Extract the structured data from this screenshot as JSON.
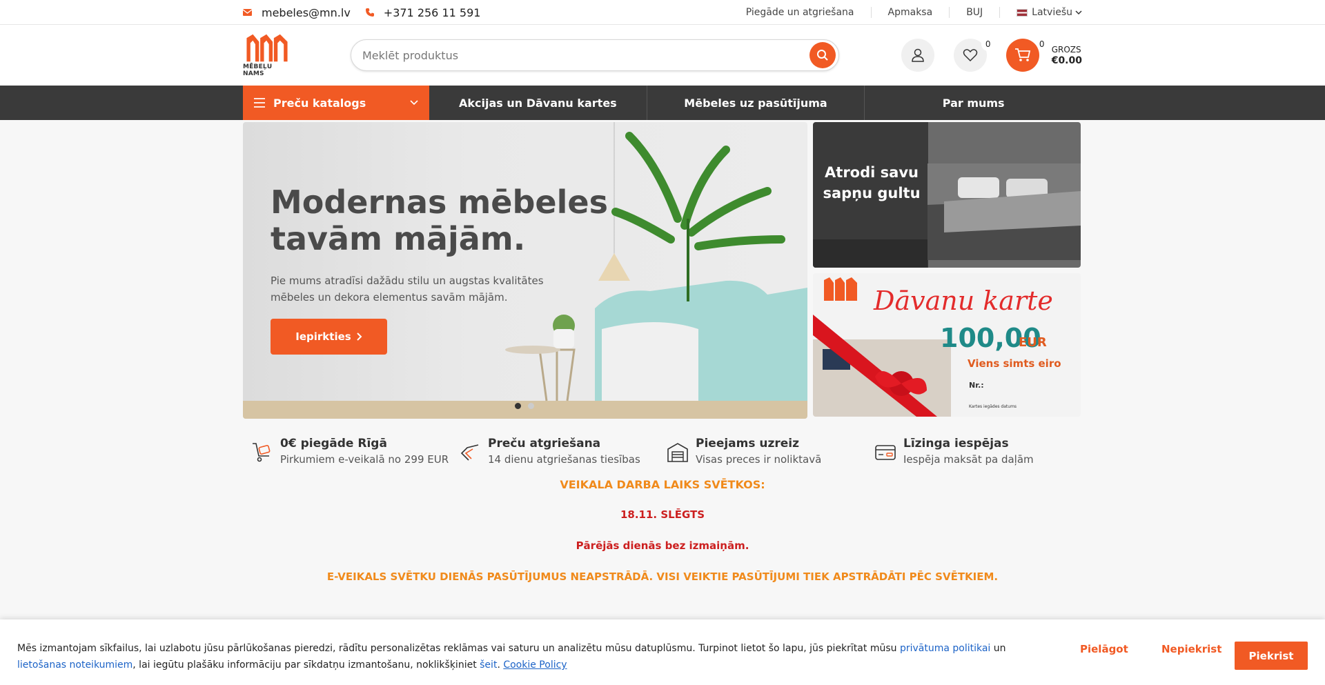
{
  "topbar": {
    "email": "mebeles@mn.lv",
    "phone": "+371 256 11 591",
    "links": [
      "Piegāde un atgriešana",
      "Apmaksa",
      "BUJ"
    ],
    "language": "Latviešu"
  },
  "header": {
    "logo_text": "MĒBEĻU NAMS",
    "search_placeholder": "Meklēt produktus",
    "wishlist_count": "0",
    "cart_count": "0",
    "cart_label": "GROZS",
    "cart_total": "€0.00"
  },
  "nav": {
    "catalog": "Preču katalogs",
    "items": [
      "Akcijas un Dāvanu kartes",
      "Mēbeles uz pasūtījuma",
      "Par mums"
    ]
  },
  "hero": {
    "title": "Modernas mēbeles tavām mājām.",
    "text": "Pie mums atradīsi dažādu stilu un augstas kvalitātes mēbeles un dekora elementus savām mājām.",
    "button": "Iepirkties"
  },
  "side_banners": {
    "bed_title": "Atrodi savu sapņu gultu",
    "gift_title": "Dāvanu karte",
    "gift_value": "100,00",
    "gift_currency": "EUR",
    "gift_words": "Viens simts eiro",
    "gift_nr": "Nr.:",
    "gift_date": "Kartes iegādes datums"
  },
  "features": [
    {
      "title": "0€ piegāde Rīgā",
      "sub": "Pirkumiem e-veikalā no 299 EUR",
      "icon": "delivery-cart-icon"
    },
    {
      "title": "Preču atgriešana",
      "sub": "14 dienu atgriešanas tiesības",
      "icon": "return-arrow-icon"
    },
    {
      "title": "Pieejams uzreiz",
      "sub": "Visas preces ir noliktavā",
      "icon": "warehouse-icon"
    },
    {
      "title": "Līzinga iespējas",
      "sub": "Iespēja maksāt pa daļām",
      "icon": "credit-card-icon"
    }
  ],
  "notices": {
    "n1": "VEIKALA DARBA LAIKS SVĒTKOS:",
    "n2": "18.11.  SLĒGTS",
    "n3": "Pārējās dienās bez izmaiņām.",
    "n4": "E-VEIKALS SVĒTKU DIENĀS PASŪTĪJUMUS NEAPSTRĀDĀ. VISI VEIKTIE PASŪTĪJUMI TIEK APSTRĀDĀTI PĒC SVĒTKIEM."
  },
  "cookie": {
    "text_a": "Mēs izmantojam sīkfailus, lai uzlabotu jūsu pārlūkošanas pieredzi, rādītu personalizētas reklāmas vai saturu un analizētu mūsu datuplūsmu. Turpinot lietot šo lapu, jūs piekrītat mūsu ",
    "link_privacy": "privātuma politikai",
    "text_b": " un ",
    "link_terms": "lietošanas noteikumiem",
    "text_c": ", lai iegūtu plašāku informāciju par sīkdatņu izmantošanu, noklikšķiniet ",
    "link_here": "šeit",
    "text_d": ". ",
    "link_policy": "Cookie Policy",
    "btn_customize": "Pielāgot",
    "btn_reject": "Nepiekrist",
    "btn_accept": "Piekrist"
  },
  "colors": {
    "accent": "#f15a24",
    "nav_bg": "#3a3a3a",
    "notice_orange": "#f08a1b",
    "notice_red": "#cc1f1f"
  }
}
